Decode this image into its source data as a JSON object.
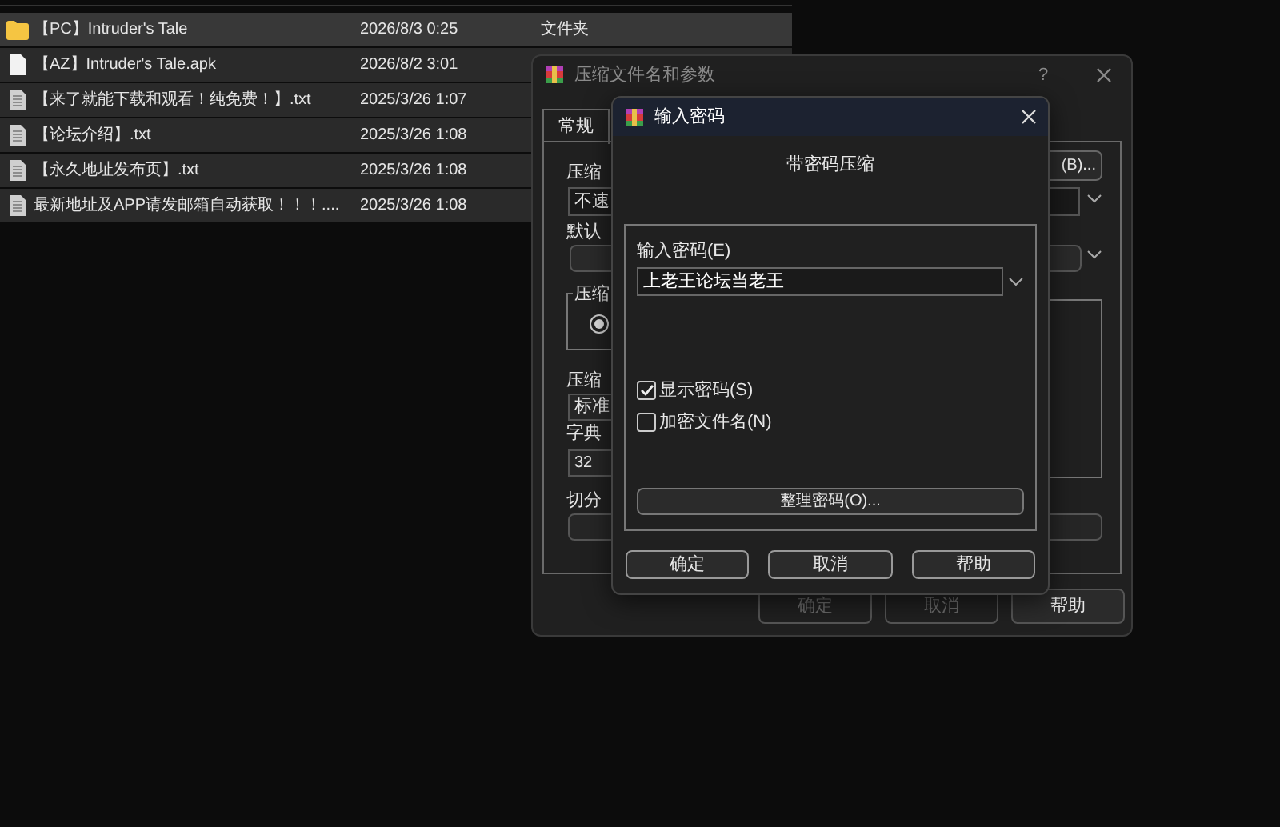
{
  "file_list": {
    "rows": [
      {
        "kind": "folder",
        "name": "【PC】Intruder's Tale",
        "date": "2026/8/3 0:25",
        "type": "文件夹",
        "selected": true
      },
      {
        "kind": "file",
        "name": "【AZ】Intruder's Tale.apk",
        "date": "2026/8/2 3:01",
        "selected": false
      },
      {
        "kind": "text",
        "name": "【来了就能下载和观看！纯免费！】.txt",
        "date": "2025/3/26 1:07",
        "selected": false
      },
      {
        "kind": "text",
        "name": "【论坛介绍】.txt",
        "date": "2025/3/26 1:08",
        "selected": false
      },
      {
        "kind": "text",
        "name": "【永久地址发布页】.txt",
        "date": "2025/3/26 1:08",
        "selected": false
      },
      {
        "kind": "text",
        "name": "最新地址及APP请发邮箱自动获取！！！....",
        "date": "2025/3/26 1:08",
        "selected": false
      }
    ]
  },
  "compress_dialog": {
    "title": "压缩文件名和参数",
    "help": "?",
    "tabs": [
      {
        "label": "常规",
        "selected": true
      }
    ],
    "archive_name_label": "压缩",
    "archive_name": "不速",
    "browse_button": "(B)...",
    "default_settings_label": "默认",
    "format_group_label": "压缩",
    "format_radio": {
      "selected": true
    },
    "method_label": "压缩",
    "method": "标准",
    "dictionary_label": "字典",
    "dictionary": "32",
    "split_label": "切分",
    "buttons": [
      {
        "label": "确定",
        "disabled": true
      },
      {
        "label": "取消",
        "disabled": true
      },
      {
        "label": "帮助",
        "disabled": false
      }
    ]
  },
  "password_dialog": {
    "title": "输入密码",
    "heading": "带密码压缩",
    "password_label": "输入密码(E)",
    "password": "上老王论坛当老王",
    "checkboxes": [
      {
        "label": "显示密码(S)",
        "checked": true
      },
      {
        "label": "加密文件名(N)",
        "checked": false
      }
    ],
    "organize_button": "整理密码(O)...",
    "buttons": [
      "确定",
      "取消",
      "帮助"
    ]
  }
}
